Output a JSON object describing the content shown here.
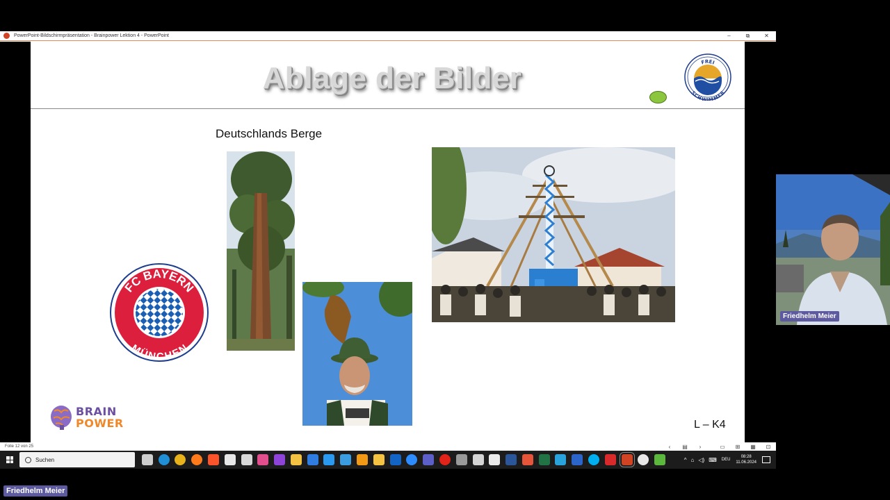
{
  "window": {
    "title": "PowerPoint-Bildschirmpräsentation  -  Brainpower Lektion 4  -  PowerPoint",
    "minimize_icon": "–",
    "restore_icon": "⧉",
    "close_icon": "✕"
  },
  "slide": {
    "title": "Ablage der Bilder",
    "subtitle": "Deutschlands Berge",
    "badge": {
      "top_text": "FREI",
      "bottom_text": "SCHWIMMER"
    },
    "fcb_logo": {
      "top_text": "FC BAYERN",
      "bottom_text": "MÜNCHEN"
    },
    "brain_logo": {
      "line1": "BRAIN",
      "line2": "POWER"
    },
    "code": "L – K4",
    "images": [
      "sequoia-tree-photo",
      "bavarian-man-with-hat-photo",
      "maypole-festival-photo"
    ]
  },
  "statusbar": {
    "slide_counter": "Folie 12 von 25",
    "controls": [
      "‹",
      "▤",
      "›",
      "▭",
      "⊞",
      "▦",
      "⊡"
    ]
  },
  "taskbar": {
    "search_placeholder": "Suchen",
    "icons": [
      {
        "name": "task-view-icon",
        "color": "#cfcfcf"
      },
      {
        "name": "edge-icon",
        "color": "#1f8fd6"
      },
      {
        "name": "chrome-icon",
        "color": "#e8b21a"
      },
      {
        "name": "firefox-icon",
        "color": "#ff7a1a"
      },
      {
        "name": "brave-icon",
        "color": "#fb542b"
      },
      {
        "name": "yahoo-icon",
        "color": "#e7e7e7"
      },
      {
        "name": "store-icon",
        "color": "#d9d9d9"
      },
      {
        "name": "paint-icon",
        "color": "#e34e8f"
      },
      {
        "name": "purple-app-icon",
        "color": "#8e44d8"
      },
      {
        "name": "explorer-icon",
        "color": "#f3c243"
      },
      {
        "name": "dropbox-icon",
        "color": "#2f7de1"
      },
      {
        "name": "onedrive-icon",
        "color": "#2a9af0"
      },
      {
        "name": "sync-icon",
        "color": "#3b9de0"
      },
      {
        "name": "sunburst-icon",
        "color": "#f29a16"
      },
      {
        "name": "chat-icon",
        "color": "#f5c342"
      },
      {
        "name": "outlook-icon",
        "color": "#1265c4"
      },
      {
        "name": "zoom-icon",
        "color": "#2d8cff"
      },
      {
        "name": "teams-icon",
        "color": "#5b5fc7"
      },
      {
        "name": "record-icon",
        "color": "#e2231a"
      },
      {
        "name": "microphone-icon",
        "color": "#9a9a9a"
      },
      {
        "name": "device-icon",
        "color": "#d4d4d4"
      },
      {
        "name": "document-icon",
        "color": "#eaeaea"
      },
      {
        "name": "word-icon",
        "color": "#2b579a"
      },
      {
        "name": "download-icon",
        "color": "#e5553a"
      },
      {
        "name": "excel-icon",
        "color": "#217346"
      },
      {
        "name": "telegram-icon",
        "color": "#2aa3dd"
      },
      {
        "name": "font-app-icon",
        "color": "#2b65c9"
      },
      {
        "name": "skype-icon",
        "color": "#00aff0"
      },
      {
        "name": "red-app-icon",
        "color": "#d82a2a"
      },
      {
        "name": "powerpoint-icon",
        "color": "#d04423"
      },
      {
        "name": "media-player-icon",
        "color": "#e8e8e8"
      },
      {
        "name": "camtasia-icon",
        "color": "#5cb83d"
      }
    ],
    "tray": {
      "chevron": "^",
      "network": "⌂",
      "volume": "◁)",
      "keyboard": "⌨",
      "language": "DEU",
      "time": "08:28",
      "date": "11.06.2024"
    }
  },
  "participant": {
    "name": "Friedhelm Meier",
    "bottom_name": "Friedhelm Meier"
  }
}
